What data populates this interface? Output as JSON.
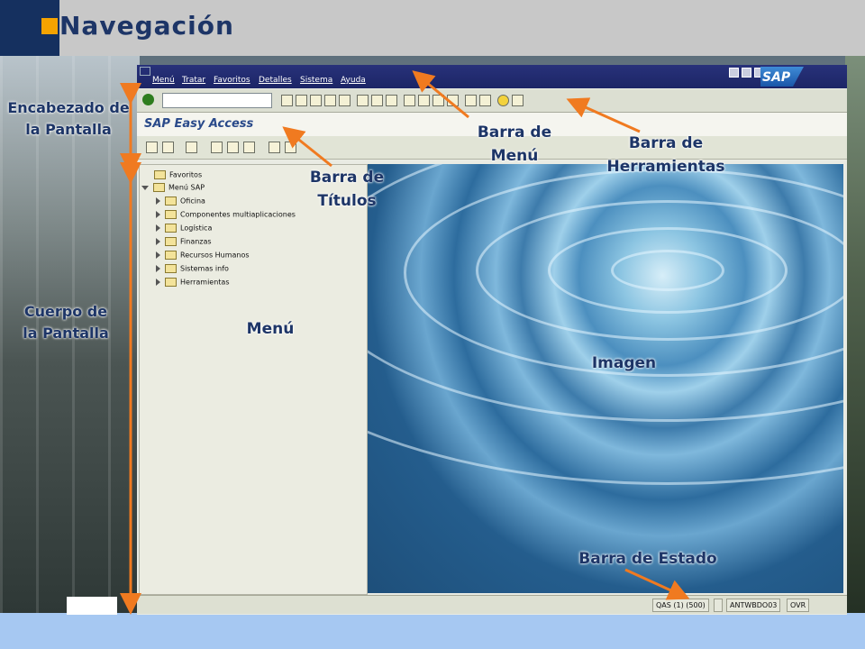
{
  "slide": {
    "title": "Navegación"
  },
  "sap": {
    "menu_bar": [
      "Menú",
      "Tratar",
      "Favoritos",
      "Detalles",
      "Sistema",
      "Ayuda"
    ],
    "logo": "SAP",
    "screen_title": "SAP Easy Access",
    "tree": {
      "favorites": "Favoritos",
      "root": "Menú SAP",
      "items": [
        "Oficina",
        "Componentes multiaplicaciones",
        "Logística",
        "Finanzas",
        "Recursos Humanos",
        "Sistemas info",
        "Herramientas"
      ]
    },
    "status": {
      "system": "QAS (1) (500)",
      "server": "ANTWBDO03",
      "mode": "OVR"
    }
  },
  "annotations": {
    "header": "Encabezado de la Pantalla",
    "body": "Cuerpo de la Pantalla",
    "menu_bar": "Barra de Menú",
    "toolbar": "Barra de Herramientas",
    "title_bar": "Barra de Títulos",
    "menu": "Menú",
    "image": "Imagen",
    "status_bar": "Barra de Estado"
  },
  "colors": {
    "title_navy": "#1d3567",
    "accent_orange": "#f07a20",
    "header_gray": "#c8c8c8",
    "footer_blue": "#a6c8f2"
  }
}
